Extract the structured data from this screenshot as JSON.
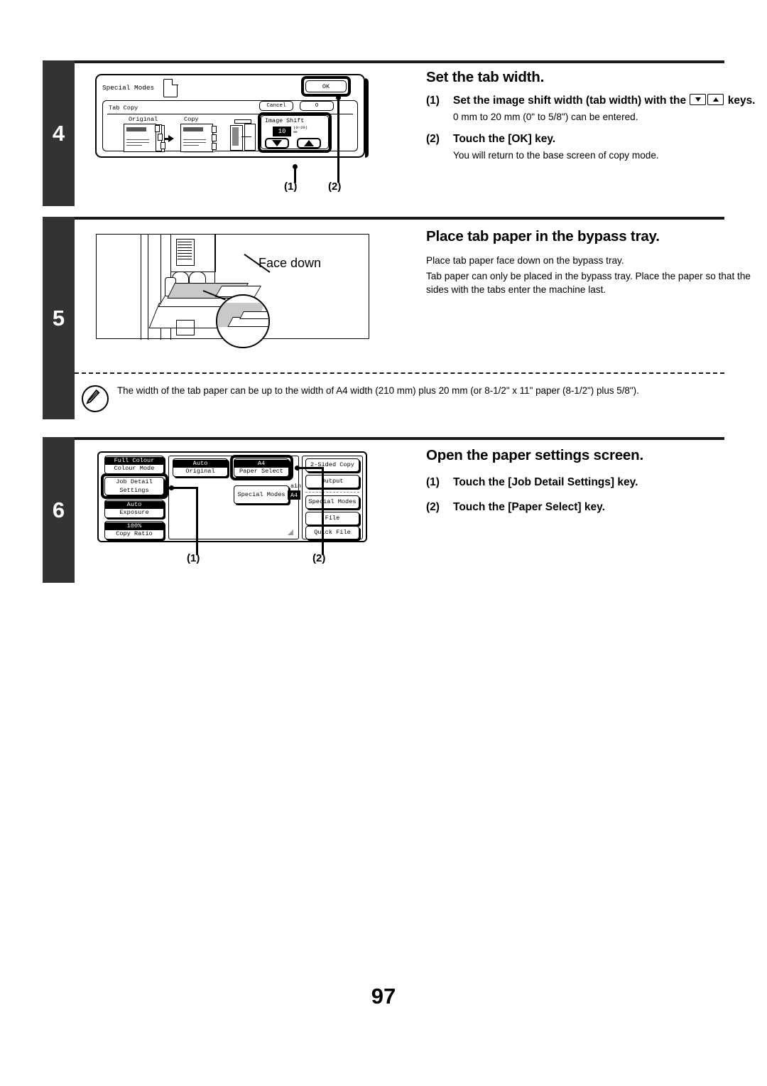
{
  "page": {
    "number": "97"
  },
  "steps": [
    {
      "number": "4",
      "heading": "Set the tab width.",
      "items": [
        {
          "marker": "(1)",
          "text_before": "Set the image shift width (tab width) with the",
          "text_after": "keys.",
          "detail": "0 mm to 20 mm (0\" to 5/8\") can be entered."
        },
        {
          "marker": "(2)",
          "text": "Touch the [OK] key.",
          "detail": "You will return to the base screen of copy mode."
        }
      ],
      "callouts": [
        "(1)",
        "(2)"
      ],
      "screen": {
        "title": "Special Modes",
        "ok_label": "OK",
        "panel_title": "Tab Copy",
        "cancel_label": "Cancel",
        "ok2_label": "O",
        "original_label": "Original",
        "copy_label": "Copy",
        "image_shift_label": "Image Shift",
        "image_shift_value": "10",
        "image_shift_range": "(0~20)",
        "image_shift_unit": "mm"
      }
    },
    {
      "number": "5",
      "heading": "Place tab paper in the bypass tray.",
      "paragraphs": [
        "Place tab paper face down on the bypass tray.",
        "Tab paper can only be placed in the bypass tray. Place the paper so that the sides with the tabs enter the machine last."
      ],
      "illustration_label": "Face down"
    },
    {
      "number": "6",
      "heading": "Open the paper settings screen.",
      "items": [
        {
          "marker": "(1)",
          "text": "Touch the [Job Detail Settings] key."
        },
        {
          "marker": "(2)",
          "text": "Touch the [Paper Select] key."
        }
      ],
      "callouts": [
        "(1)",
        "(2)"
      ],
      "screen": {
        "left_keys": [
          {
            "top": "Full Colour",
            "bottom": "Colour Mode"
          },
          {
            "top": "",
            "bottom": "Job Detail Settings"
          },
          {
            "top": "Auto",
            "bottom": "Exposure"
          },
          {
            "top": "100%",
            "bottom": "Copy Ratio"
          }
        ],
        "center_keys": [
          {
            "top": "Auto",
            "bottom": "Original"
          },
          {
            "top": "A4",
            "bottom": "Paper Select"
          },
          {
            "top": "",
            "bottom": "Special Modes"
          }
        ],
        "status_text_1": "ain",
        "status_text_2": "A4",
        "right_keys": [
          "2-Sided Copy",
          "Output",
          "Special Modes",
          "File",
          "Quick File"
        ]
      }
    }
  ],
  "note": {
    "icon": "pencil-note-icon",
    "text": "The width of the tab paper can be up to the width of A4 width (210 mm) plus 20 mm (or 8-1/2\" x 11\" paper (8-1/2\") plus 5/8\")."
  },
  "colors": {
    "step_block": "#333333",
    "rule": "#1a1a1a",
    "ink": "#000000",
    "paper_gray": "#c9c9c9"
  }
}
